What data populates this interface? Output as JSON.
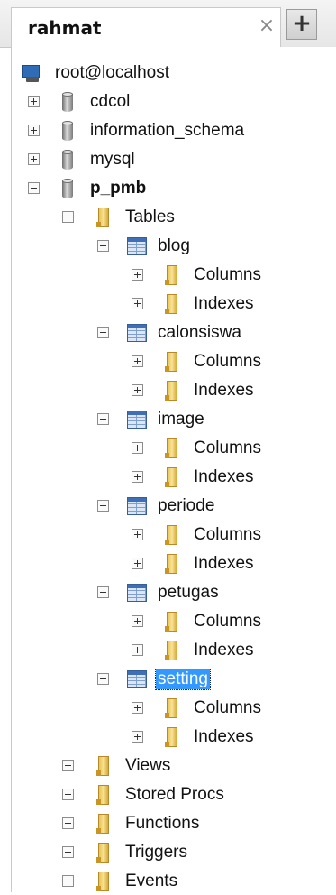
{
  "tab": {
    "title": "rahmat",
    "close_glyph": "×",
    "add_glyph": "+"
  },
  "icons": {
    "server": "server-icon",
    "database": "database-icon",
    "folder": "folder-icon",
    "table": "table-icon",
    "expand": "plus-box-icon",
    "collapse": "minus-box-icon"
  },
  "colors": {
    "selection": "#3399ff",
    "folder": "#e8c44e",
    "table": "#3e6fb7"
  },
  "tree": {
    "root": "root@localhost",
    "databases": [
      {
        "name": "cdcol"
      },
      {
        "name": "information_schema"
      },
      {
        "name": "mysql"
      },
      {
        "name": "p_pmb"
      }
    ],
    "p_pmb": {
      "tables_label": "Tables",
      "tables": [
        "blog",
        "calonsiswa",
        "image",
        "periode",
        "petugas",
        "setting"
      ],
      "columns_label": "Columns",
      "indexes_label": "Indexes",
      "folders": [
        "Views",
        "Stored Procs",
        "Functions",
        "Triggers",
        "Events"
      ]
    }
  }
}
